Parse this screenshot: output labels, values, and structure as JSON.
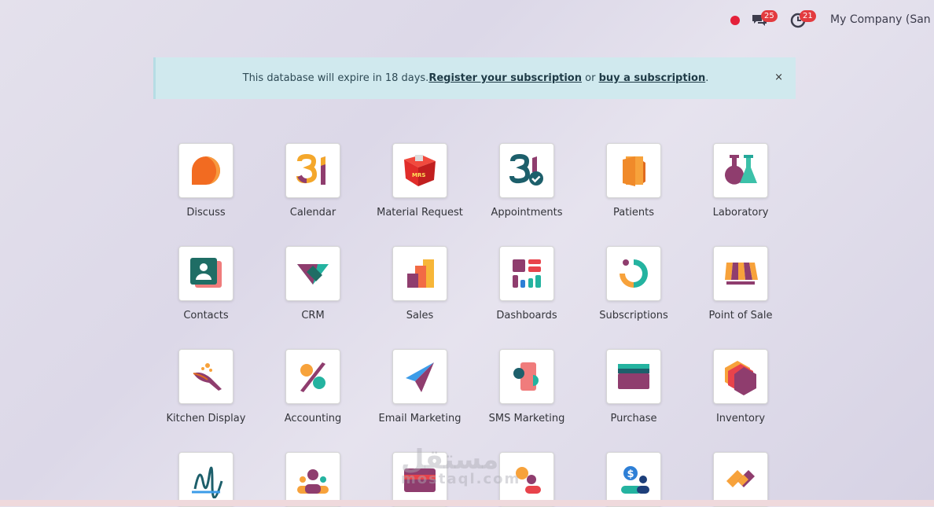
{
  "topbar": {
    "message_count": "25",
    "activity_count": "21",
    "company": "My Company (San Fra"
  },
  "banner": {
    "text_before": "This database will expire in 18 days. ",
    "register_link": "Register your subscription",
    "text_middle": " or ",
    "buy_link": "buy a subscription",
    "text_after": ".",
    "close": "×"
  },
  "apps": [
    {
      "label": "Discuss",
      "icon": "discuss-icon"
    },
    {
      "label": "Calendar",
      "icon": "calendar-icon"
    },
    {
      "label": "Material Request",
      "icon": "material-request-icon"
    },
    {
      "label": "Appointments",
      "icon": "appointments-icon"
    },
    {
      "label": "Patients",
      "icon": "patients-icon"
    },
    {
      "label": "Laboratory",
      "icon": "laboratory-icon"
    },
    {
      "label": "Contacts",
      "icon": "contacts-icon"
    },
    {
      "label": "CRM",
      "icon": "crm-icon"
    },
    {
      "label": "Sales",
      "icon": "sales-icon"
    },
    {
      "label": "Dashboards",
      "icon": "dashboards-icon"
    },
    {
      "label": "Subscriptions",
      "icon": "subscriptions-icon"
    },
    {
      "label": "Point of Sale",
      "icon": "point-of-sale-icon"
    },
    {
      "label": "Kitchen Display",
      "icon": "kitchen-display-icon"
    },
    {
      "label": "Accounting",
      "icon": "accounting-icon"
    },
    {
      "label": "Email Marketing",
      "icon": "email-marketing-icon"
    },
    {
      "label": "SMS Marketing",
      "icon": "sms-marketing-icon"
    },
    {
      "label": "Purchase",
      "icon": "purchase-icon"
    },
    {
      "label": "Inventory",
      "icon": "inventory-icon"
    },
    {
      "label": "",
      "icon": "sign-icon"
    },
    {
      "label": "",
      "icon": "employees-icon"
    },
    {
      "label": "",
      "icon": "expenses-icon"
    },
    {
      "label": "",
      "icon": "referrals-icon"
    },
    {
      "label": "",
      "icon": "payroll-icon"
    },
    {
      "label": "",
      "icon": "connector-icon"
    }
  ],
  "watermark": {
    "arabic": "مستقل",
    "latin": "mostaql.com"
  },
  "colors": {
    "badge": "#e33b3f",
    "banner": "#d0e9ee",
    "record": "#e4203a"
  }
}
